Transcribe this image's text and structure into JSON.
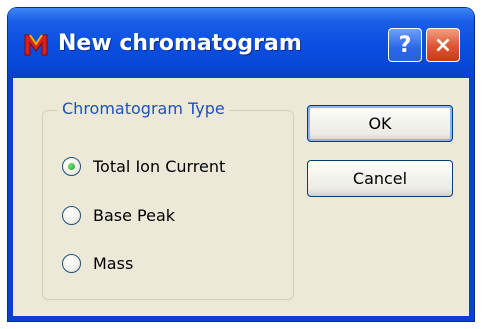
{
  "window": {
    "title": "New chromatogram",
    "app_icon": "m-app-icon",
    "help_label": "?",
    "close_label": "×"
  },
  "group": {
    "legend": "Chromatogram Type",
    "options": [
      {
        "label": "Total Ion Current",
        "checked": true
      },
      {
        "label": "Base Peak",
        "checked": false
      },
      {
        "label": "Mass",
        "checked": false
      }
    ]
  },
  "buttons": {
    "ok_label": "OK",
    "cancel_label": "Cancel"
  },
  "colors": {
    "title_bar": "#0a4ee0",
    "client_bg": "#ece9d8",
    "legend_text": "#1f4fc0",
    "close_button": "#de5430",
    "app_icon_red": "#d81e1e"
  }
}
